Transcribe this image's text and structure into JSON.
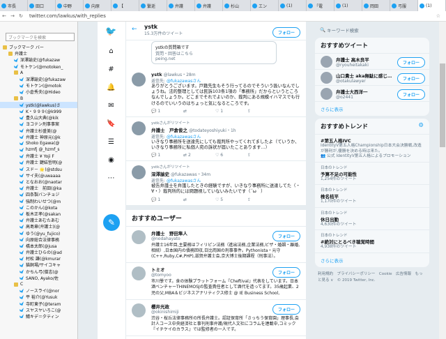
{
  "tabs": [
    {
      "label": "市長"
    },
    {
      "label": "田口"
    },
    {
      "label": "中野"
    },
    {
      "label": "向原"
    },
    {
      "label": "【"
    },
    {
      "label": "繋逝"
    },
    {
      "label": "弁護"
    },
    {
      "label": "弁護"
    },
    {
      "label": "杉山"
    },
    {
      "label": "エン"
    },
    {
      "label": "(1)"
    },
    {
      "label": "「電"
    },
    {
      "label": "(1)"
    },
    {
      "label": "岡田"
    },
    {
      "label": "弓服"
    },
    {
      "label": "(1)"
    }
  ],
  "url": "twitter.com/lawkus/with_replies",
  "sidebar": {
    "search_placeholder": "ブックマークを検索",
    "items": [
      {
        "label": "ブックマーク バー",
        "type": "f",
        "lvl": 0
      },
      {
        "label": "弁護士",
        "type": "f",
        "lvl": 1
      },
      {
        "label": "深澤諭史(@fukazaw",
        "type": "b",
        "lvl": 2
      },
      {
        "label": "モトケン(@motoken_",
        "type": "b",
        "lvl": 2
      },
      {
        "label": "A",
        "type": "f",
        "lvl": 2
      },
      {
        "label": "深澤諭史(@fukazaw",
        "type": "b",
        "lvl": 3
      },
      {
        "label": "モトケン(@motok",
        "type": "b",
        "lvl": 3
      },
      {
        "label": "小倉秀夫(@Hideo",
        "type": "b",
        "lvl": 3
      },
      {
        "label": "B",
        "type": "f",
        "lvl": 2
      },
      {
        "label": "ystk(@lawkus)さ",
        "type": "b",
        "lvl": 3,
        "sel": true
      },
      {
        "label": "K・９９９(@k999",
        "type": "b",
        "lvl": 3
      },
      {
        "label": "豊久山大典(@kik",
        "type": "b",
        "lvl": 3
      },
      {
        "label": "ヨコテン刑事事案",
        "type": "b",
        "lvl": 3
      },
      {
        "label": "弁護士杉盛美(@",
        "type": "b",
        "lvl": 3
      },
      {
        "label": "弁護士 神原元(@k",
        "type": "b",
        "lvl": 3
      },
      {
        "label": "Shoko Egawa(@",
        "type": "b",
        "lvl": 3
      },
      {
        "label": "hzmfj @_hzmf_s",
        "type": "b",
        "lvl": 3
      },
      {
        "label": "弁護士 ¥ Yoji F",
        "type": "b",
        "lvl": 3
      },
      {
        "label": "弁護士 鍵結哲明(@",
        "type": "b",
        "lvl": 3
      },
      {
        "label": "スド－ 🌟(@stdsu",
        "type": "b",
        "lvl": 3
      },
      {
        "label": "サイ夫(@uwaaaa",
        "type": "b",
        "lvl": 3
      },
      {
        "label": "となおお(@naotar",
        "type": "b",
        "lvl": 3
      },
      {
        "label": "弁護士　前田(@ka",
        "type": "b",
        "lvl": 3
      },
      {
        "label": "四条製バンチョジ",
        "type": "b",
        "lvl": 3
      },
      {
        "label": "強制わいせつ(@m",
        "type": "b",
        "lvl": 3
      },
      {
        "label": "このかん(@kota",
        "type": "b",
        "lvl": 3
      },
      {
        "label": "板木正孝(@sakan",
        "type": "b",
        "lvl": 3
      },
      {
        "label": "弁護士あむたあむ",
        "type": "b",
        "lvl": 3
      },
      {
        "label": "高島章(弁護士)(@",
        "type": "b",
        "lvl": 3
      },
      {
        "label": "ゆう(@yu_fujico)",
        "type": "b",
        "lvl": 3
      },
      {
        "label": "向原総合法律事務",
        "type": "b",
        "lvl": 3
      },
      {
        "label": "橋本太郎(@jusa",
        "type": "b",
        "lvl": 3
      },
      {
        "label": "弁護士ひらの(@ad",
        "type": "b",
        "lvl": 3
      },
      {
        "label": "村松 謙(@kmurar",
        "type": "b",
        "lvl": 3
      },
      {
        "label": "猫飼場/サイコキャ",
        "type": "b",
        "lvl": 3
      },
      {
        "label": "かちん弓(僧志(@",
        "type": "b",
        "lvl": 3
      },
      {
        "label": "SANO, Ayako/佐",
        "type": "b",
        "lvl": 3
      },
      {
        "label": "C",
        "type": "f",
        "lvl": 2
      },
      {
        "label": "ノースライ(@nor",
        "type": "b",
        "lvl": 3
      },
      {
        "label": "平 裕介(@Yusuk",
        "type": "b",
        "lvl": 3
      },
      {
        "label": "寺町東子(@teram",
        "type": "b",
        "lvl": 3
      },
      {
        "label": "スヤスヤいろこ(@",
        "type": "b",
        "lvl": 3
      },
      {
        "label": "鯖キデ＝夕ティン",
        "type": "b",
        "lvl": 3
      }
    ]
  },
  "profile": {
    "back": "←",
    "name": "ystk",
    "count": "15.3万件のツイート",
    "follow": "フォロー"
  },
  "card": {
    "title": "ystkの質問箱です",
    "sub": "質問・回答はこちら",
    "link": "peing.net"
  },
  "tweets": [
    {
      "rt": "",
      "name": "ystk",
      "handle": "@lawkus・28m",
      "reply_to": "返信先: ",
      "reply_user": "@fukazawasさん",
      "text": "ありがとうございます。戸籍先生もそう行ってるのでそういう扱いなんでしょうね。法的整理としては民訴103条1項の「事務所」だからというところなんでしょうか。どこまでそれでよいのか、裁判にある規模イハマスでも行けるのでいいうのはちょっと気になるところです。",
      "reply": "1",
      "retweet": "",
      "like": "1"
    },
    {
      "rt": "ystkさんがリツイート",
      "name": "弁護士　戸倉俊之",
      "handle": "@todateyoshiyuki・1h",
      "reply_to": "返信先: ",
      "reply_user": "@fukazawasさん",
      "text": "いきなり事務所を送達先にしても裁判所やってくれてましたよ（ていうか、いきなり事務所に私個人宛の訴状が届いたことあります…）",
      "reply": "1",
      "retweet": "2",
      "like": "6"
    },
    {
      "rt": "ystkさんがリツイート",
      "name": "深澤諭史",
      "handle": "@fukazawas・34m",
      "reply_to": "返信先: ",
      "reply_user": "@fukazawasさん",
      "text": "被告弁護士を弁護したときの経験ですが、いきなり事務所に送達してた（・∀・）裁判所的には問題視していないみたいです（´ω｀）",
      "reply": "1",
      "retweet": "",
      "like": "5"
    }
  ],
  "recommend": {
    "title": "おすすめユーザー",
    "users": [
      {
        "name": "弁護士　野田隼人",
        "handle": "@nodahayato",
        "bio": "弁護士16年目,主要務はフィリピン法務（進出法務,企業法務,ビザ・婚姻・離婚,相続）,日本国内の債務回収,日比両国の刑事事件。Pythonista・元守(C++,Ruby,C#,PHP),滋賀弁護士会,京大博士後期課程（刑事法）。"
      },
      {
        "name": "トミオ",
        "handle": "@tomyoo",
        "bio": "市川學です。食の体験プラットフォーム『Cheftival』代表をしています。日本酒ベンチャーTHINEMOSJの監査責任者として酒代を造ってます。35歳起業、2児の父,MBA＆ビジネスアナリティクス修士 @ IE Business School,"
      },
      {
        "name": "櫻井光政",
        "handle": "@okinishimiji",
        "bio": "渋谷・桜丘法律事務所の所長弁護士。認証保育所「さっちう保育園」理事長,会計人コース中央経済社と事刊刑事弁護/現代人文社にコラムを連載中,コミック『イチケイのカラス』では監修者の一人です。"
      }
    ]
  },
  "right": {
    "search_placeholder": "キーワード検索",
    "accounts_title": "おすすめツイート",
    "accounts": [
      {
        "name": "弁護士 高木良平",
        "handle": "@ryouheitakaki",
        "follow": "フォロー"
      },
      {
        "name": "山口貴士 aka無駄に感じ…",
        "handle": "@otakulawyer",
        "follow": "フォロー"
      },
      {
        "name": "弁護士大西洋一",
        "handle": "@o2441",
        "follow": "フォロー"
      }
    ],
    "more": "さらに表示",
    "trends_title": "おすすめトレンド",
    "trends": [
      {
        "label": "",
        "name": "#第五人格IVC",
        "detail": "IdentityV第五人格Championship日本大会決勝戦,改造が勝利が,優勝を決める時は来た。",
        "extra": "👥 公式 IdentityV第五人格によるプロモーション"
      },
      {
        "label": "日本のトレンド",
        "name": "予算不足の可能性",
        "detail": "1,254件のツイート",
        "extra": ""
      },
      {
        "label": "日本のトレンド",
        "name": "椎名桔平",
        "detail": "1,170件のツイート",
        "extra": ""
      },
      {
        "label": "日本のトレンド",
        "name": "休日出勤",
        "detail": "4,630件のツイート",
        "extra": ""
      },
      {
        "label": "日本のトレンド",
        "name": "#絶対にとるべき聴覚時間",
        "detail": "4,938件のツイート",
        "extra": ""
      }
    ],
    "trends_more": "さらに表示",
    "footer": "利用規約　プライバシーポリシー　Cookie　広告情報　もっと見る ∨　© 2019 Twitter, Inc."
  }
}
